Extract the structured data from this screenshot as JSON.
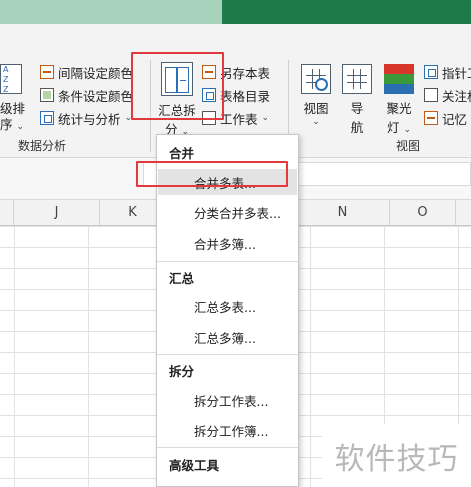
{
  "ribbon": {
    "sort": {
      "label_line1": "级排",
      "label_line2": "序"
    },
    "data_analysis": {
      "items": [
        {
          "label": "间隔设定颜色"
        },
        {
          "label": "条件设定颜色"
        },
        {
          "label": "统计与分析"
        }
      ],
      "group_label": "数据分析"
    },
    "merge_split_button": {
      "line1": "汇总拆",
      "line2": "分"
    },
    "table_items": [
      {
        "label": "另存本表"
      },
      {
        "label": "表格目录"
      },
      {
        "label": "工作表"
      }
    ],
    "view_group": {
      "buttons": [
        {
          "line1": "视图",
          "line2": ""
        },
        {
          "line1": "导",
          "line2": "航"
        },
        {
          "line1": "聚光",
          "line2": "灯"
        }
      ],
      "group_label": "视图"
    },
    "right_items": [
      {
        "label": "指针工"
      },
      {
        "label": "关注格"
      },
      {
        "label": "记忆"
      }
    ]
  },
  "sheet": {
    "columns": [
      "J",
      "K",
      "N",
      "O"
    ]
  },
  "dropdown": {
    "sections": [
      {
        "heading": "合并",
        "items": [
          "合并多表...",
          "分类合并多表...",
          "合并多簿..."
        ]
      },
      {
        "heading": "汇总",
        "items": [
          "汇总多表...",
          "汇总多簿..."
        ]
      },
      {
        "heading": "拆分",
        "items": [
          "拆分工作表...",
          "拆分工作簿..."
        ]
      },
      {
        "heading": "高级工具",
        "items": []
      }
    ],
    "highlighted": "合并多表..."
  },
  "watermark": "软件技巧"
}
